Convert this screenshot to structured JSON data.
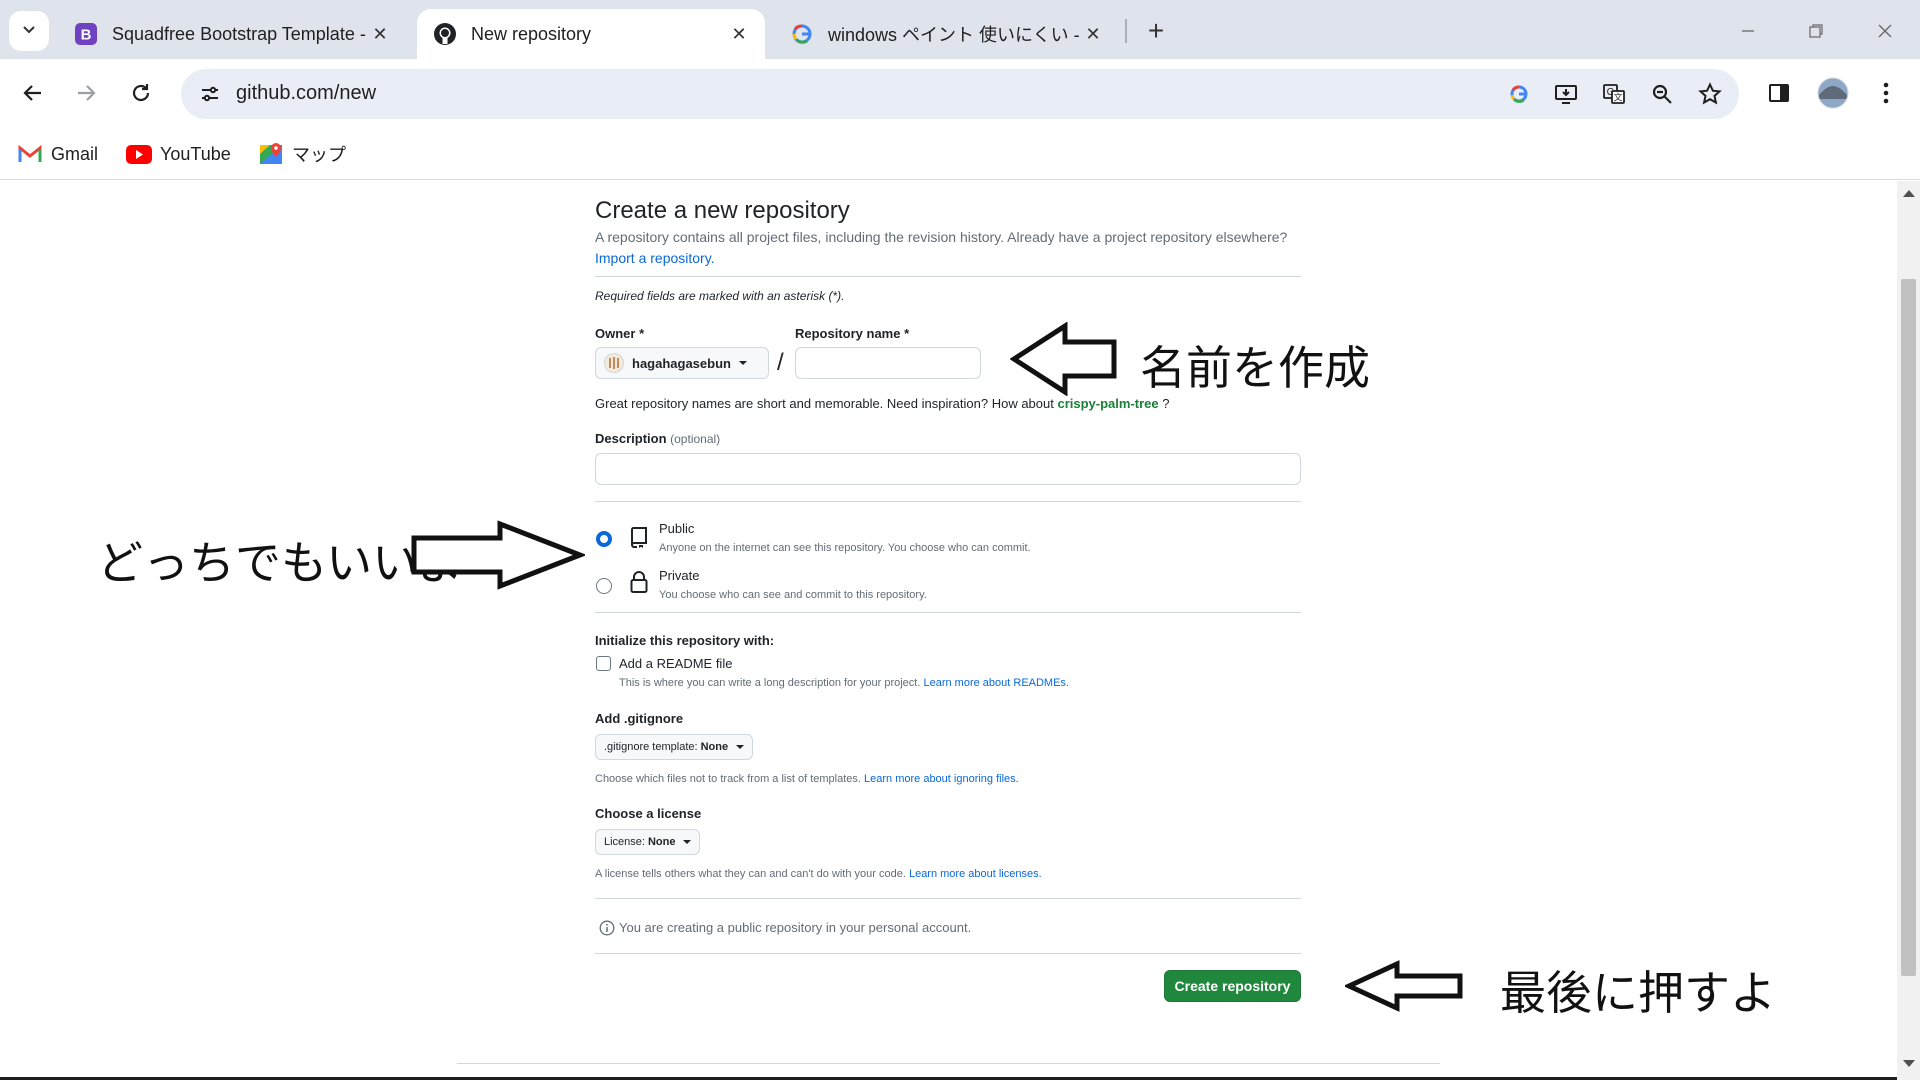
{
  "browser": {
    "tabs": [
      {
        "title": "Squadfree Bootstrap Template -",
        "favicon": "bootstrap-icon"
      },
      {
        "title": "New repository",
        "favicon": "github-icon"
      },
      {
        "title": "windows ペイント 使いにくい - Goo",
        "favicon": "google-icon"
      }
    ],
    "url": "github.com/new",
    "bookmarks": [
      {
        "label": "Gmail",
        "icon": "gmail-icon"
      },
      {
        "label": "YouTube",
        "icon": "youtube-icon"
      },
      {
        "label": "マップ",
        "icon": "maps-icon"
      }
    ]
  },
  "page": {
    "title": "Create a new repository",
    "intro": "A repository contains all project files, including the revision history. Already have a project repository elsewhere?",
    "import_link": "Import a repository.",
    "required_note": "Required fields are marked with an asterisk (*).",
    "owner_label": "Owner *",
    "owner_value": "hagahagasebun",
    "repo_label": "Repository name *",
    "repo_value": "",
    "separator": "/",
    "name_hint": "Great repository names are short and memorable. Need inspiration? How about",
    "name_suggestion": "crispy-palm-tree",
    "name_hint_end": "?",
    "description_label": "Description",
    "description_optional": "(optional)",
    "description_value": "",
    "visibility": {
      "selected": "Public",
      "public_title": "Public",
      "public_desc": "Anyone on the internet can see this repository. You choose who can commit.",
      "private_title": "Private",
      "private_desc": "You choose who can see and commit to this repository."
    },
    "init_label": "Initialize this repository with:",
    "readme_label": "Add a README file",
    "readme_checked": false,
    "readme_desc": "This is where you can write a long description for your project.",
    "readme_link": "Learn more about READMEs.",
    "gitignore_label": "Add .gitignore",
    "gitignore_button_prefix": ".gitignore template:",
    "gitignore_button_value": "None",
    "gitignore_desc": "Choose which files not to track from a list of templates.",
    "gitignore_link": "Learn more about ignoring files.",
    "license_label": "Choose a license",
    "license_button_prefix": "License:",
    "license_button_value": "None",
    "license_desc": "A license tells others what they can and can't do with your code.",
    "license_link": "Learn more about licenses.",
    "notice": "You are creating a public repository in your personal account.",
    "create_button": "Create repository"
  },
  "annotations": {
    "name": "名前を作成",
    "visibility": "どっちでもいいよ",
    "create": "最後に押すよ"
  },
  "colors": {
    "primary_button": "#1f883d",
    "link": "#0969da",
    "radio_selected": "#0969da",
    "tabstrip": "#dfe3eb",
    "omnibox": "#e9eef6"
  }
}
